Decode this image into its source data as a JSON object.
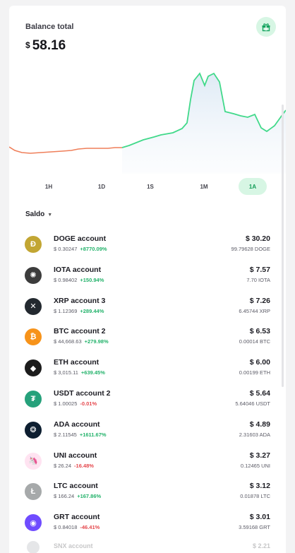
{
  "balance": {
    "title": "Balance total",
    "currency": "$",
    "amount": "58.16"
  },
  "chart_meta": {
    "faint_label": ""
  },
  "ranges": [
    {
      "label": "1H",
      "active": false
    },
    {
      "label": "1D",
      "active": false
    },
    {
      "label": "1S",
      "active": false
    },
    {
      "label": "1M",
      "active": false
    },
    {
      "label": "1A",
      "active": true
    }
  ],
  "saldo": {
    "label": "Saldo"
  },
  "accounts": [
    {
      "name": "DOGE account",
      "price": "$ 0.30247",
      "change": "+8770.09%",
      "dir": "up",
      "value": "$ 30.20",
      "qty": "99.79628 DOGE",
      "icon": "doge-icon",
      "color": "#c2a633",
      "glyph": "Ð"
    },
    {
      "name": "IOTA account",
      "price": "$ 0.98402",
      "change": "+150.94%",
      "dir": "up",
      "value": "$ 7.57",
      "qty": "7.70 IOTA",
      "icon": "iota-icon",
      "color": "#3c3c3c",
      "glyph": "✺"
    },
    {
      "name": "XRP account 3",
      "price": "$ 1.12369",
      "change": "+289.44%",
      "dir": "up",
      "value": "$ 7.26",
      "qty": "6.45744 XRP",
      "icon": "xrp-icon",
      "color": "#23292f",
      "glyph": "✕"
    },
    {
      "name": "BTC account 2",
      "price": "$ 44,668.63",
      "change": "+279.98%",
      "dir": "up",
      "value": "$ 6.53",
      "qty": "0.00014 BTC",
      "icon": "btc-icon",
      "color": "#f7931a",
      "glyph": "₿"
    },
    {
      "name": "ETH account",
      "price": "$ 3,015.11",
      "change": "+639.45%",
      "dir": "up",
      "value": "$ 6.00",
      "qty": "0.00199 ETH",
      "icon": "eth-icon",
      "color": "#1c1c1c",
      "glyph": "◆"
    },
    {
      "name": "USDT account 2",
      "price": "$ 1.00025",
      "change": "-0.01%",
      "dir": "down",
      "value": "$ 5.64",
      "qty": "5.64046 USDT",
      "icon": "usdt-icon",
      "color": "#26a17b",
      "glyph": "₮"
    },
    {
      "name": "ADA account",
      "price": "$ 2.11545",
      "change": "+1611.67%",
      "dir": "up",
      "value": "$ 4.89",
      "qty": "2.31603 ADA",
      "icon": "ada-icon",
      "color": "#0d1e30",
      "glyph": "❂"
    },
    {
      "name": "UNI account",
      "price": "$ 26.24",
      "change": "-16.48%",
      "dir": "down",
      "value": "$ 3.27",
      "qty": "0.12465 UNI",
      "icon": "uni-icon",
      "color": "#ffe3f1",
      "glyph": "🦄"
    },
    {
      "name": "LTC account",
      "price": "$ 166.24",
      "change": "+167.86%",
      "dir": "up",
      "value": "$ 3.12",
      "qty": "0.01878 LTC",
      "icon": "ltc-icon",
      "color": "#a6a9aa",
      "glyph": "Ł"
    },
    {
      "name": "GRT account",
      "price": "$ 0.84018",
      "change": "-46.41%",
      "dir": "down",
      "value": "$ 3.01",
      "qty": "3.59168 GRT",
      "icon": "grt-icon",
      "color": "#6f4cff",
      "glyph": "◉"
    }
  ],
  "faded_account": {
    "name": "SNX account",
    "value": "$ 2.21"
  },
  "colors": {
    "accent": "#22b26a",
    "accent_bg": "#d7f6e4",
    "loss_line": "#ef7f5a",
    "gain_line": "#41d98a"
  }
}
